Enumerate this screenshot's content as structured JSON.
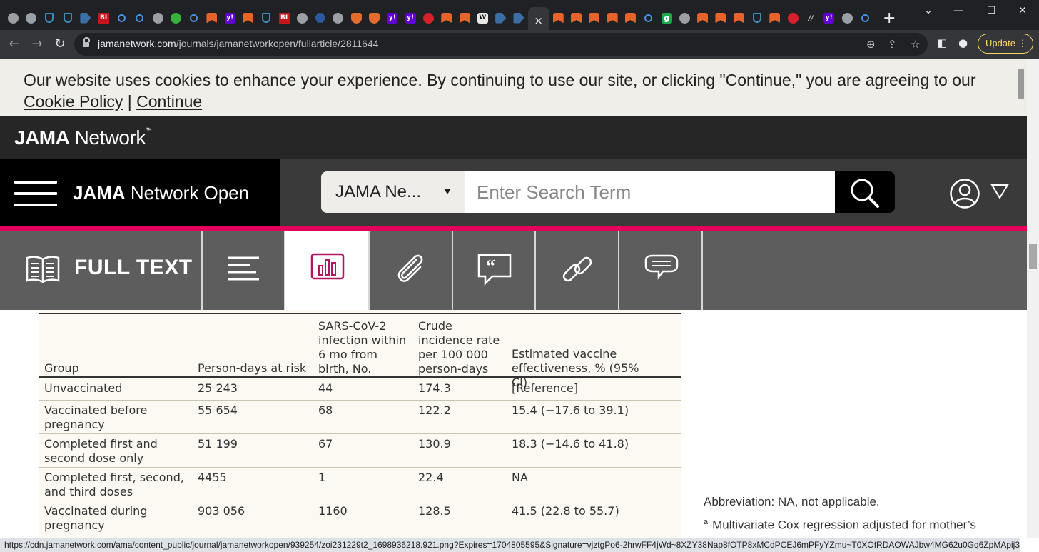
{
  "browser": {
    "tab_favicons": [
      "globe",
      "globe",
      "shield",
      "shield",
      "arrow",
      "bi",
      "search",
      "search",
      "globe",
      "play",
      "search",
      "bookmark",
      "yahoo",
      "bookmark",
      "shield",
      "bi",
      "globe",
      "hex",
      "globe",
      "shieldred",
      "shieldred",
      "yahoo",
      "yahoo",
      "red",
      "bookmark",
      "bookmark",
      "wp",
      "arrow",
      "arrow"
    ],
    "active_tab_close": "×",
    "tab_favicons_after": [
      "bookmark",
      "bookmark",
      "bookmark",
      "bookmark",
      "bookmark",
      "search",
      "g",
      "globe",
      "bookmark",
      "bookmark",
      "bookmark",
      "shield",
      "bookmark",
      "red",
      "slash",
      "yahoo",
      "globe",
      "search"
    ],
    "new_tab": "+",
    "url_host": "jamanetwork.com",
    "url_path": "/journals/jamanetworkopen/fullarticle/2811644",
    "update_label": "Update",
    "status_url": "https://cdn.jamanetwork.com/ama/content_public/journal/jamanetworkopen/939254/zoi231229t2_1698936218.921.png?Expires=1704805595&Signature=vjztgPo6-2hrwFF4jWd~8XZY38Nap8fOTP8xMCdPCEJ6mPFyYZmu~T0XOfRDAOWAJbw4MG62u0Gq6ZpMApij3Q27mB6TBTY..."
  },
  "cookie_banner": {
    "text": "Our website uses cookies to enhance your experience. By continuing to use our site, or clicking \"Continue,\" you are agreeing to our ",
    "policy_link": "Cookie Policy",
    "separator": " | ",
    "continue_link": "Continue"
  },
  "header": {
    "network_logo_bold": "JAMA",
    "network_logo_rest": " Network",
    "network_logo_tm": "™",
    "journal_bold": "JAMA",
    "journal_rest": " Network Open",
    "search_scope": "JAMA Ne...",
    "search_placeholder": "Enter Search Term"
  },
  "toolbar": {
    "full_text_label": "FULL TEXT"
  },
  "table": {
    "headers": {
      "group": "Group",
      "person_days": "Person-days at risk",
      "infection": "SARS-CoV-2 infection within 6 mo from birth, No.",
      "incidence": "Crude incidence rate per 100 000 person-days",
      "effectiveness": "Estimated vaccine effectiveness, % (95% CI)"
    },
    "rows": [
      {
        "group": "Unvaccinated",
        "person_days": "25 243",
        "infection": "44",
        "incidence": "174.3",
        "effectiveness": "[Reference]"
      },
      {
        "group": "Vaccinated before pregnancy",
        "person_days": "55 654",
        "infection": "68",
        "incidence": "122.2",
        "effectiveness": "15.4 (−17.6 to 39.1)"
      },
      {
        "group": "Completed first and second dose only",
        "person_days": "51 199",
        "infection": "67",
        "incidence": "130.9",
        "effectiveness": "18.3 (−14.6 to 41.8)"
      },
      {
        "group": "Completed first, second, and third doses",
        "person_days": "4455",
        "infection": "1",
        "incidence": "22.4",
        "effectiveness": "NA"
      },
      {
        "group": "Vaccinated during pregnancy",
        "person_days": "903 056",
        "infection": "1160",
        "incidence": "128.5",
        "effectiveness": "41.5 (22.8 to 55.7)"
      }
    ]
  },
  "notes": {
    "abbreviation": "Abbreviation: NA, not applicable.",
    "footnote_marker": "a",
    "footnote_text": "Multivariate Cox regression adjusted for mother’s"
  }
}
